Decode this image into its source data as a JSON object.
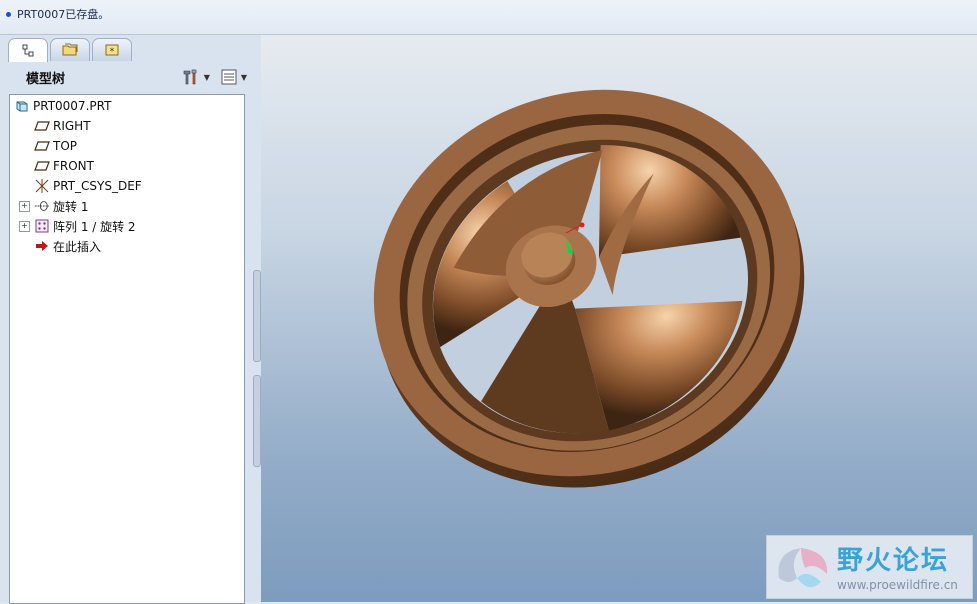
{
  "message": {
    "text": "PRT0007已存盘。"
  },
  "panel": {
    "title": "模型树"
  },
  "tree": {
    "root": "PRT0007.PRT",
    "items": [
      {
        "label": "RIGHT",
        "icon": "datum-plane-icon"
      },
      {
        "label": "TOP",
        "icon": "datum-plane-icon"
      },
      {
        "label": "FRONT",
        "icon": "datum-plane-icon"
      },
      {
        "label": "PRT_CSYS_DEF",
        "icon": "csys-icon"
      },
      {
        "label": "旋转 1",
        "icon": "revolve-icon"
      },
      {
        "label": "阵列 1 / 旋转 2",
        "icon": "pattern-icon"
      },
      {
        "label": "在此插入",
        "icon": "insert-here-arrow-icon"
      }
    ]
  },
  "watermark": {
    "title": "野火论坛",
    "url": "www.proewildfire.cn"
  },
  "colors": {
    "part": "#8b5a36",
    "highlight": "#f2c59a",
    "viewport_bottom": "#7d9cbe"
  }
}
